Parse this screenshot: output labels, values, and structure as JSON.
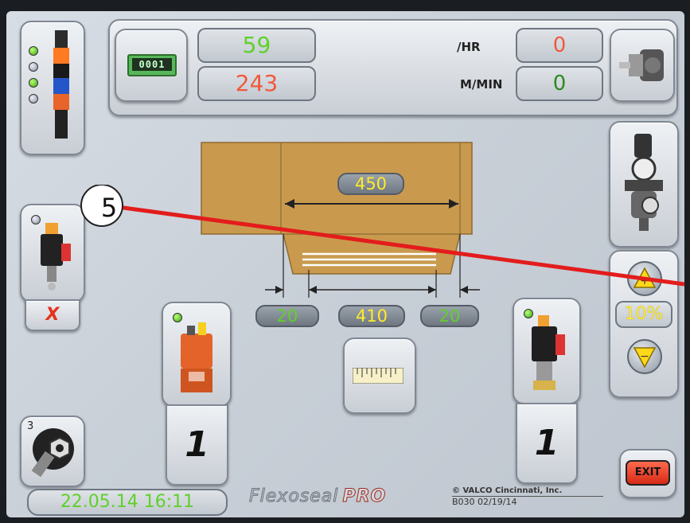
{
  "counter_top": "59",
  "counter_bottom": "243",
  "rate_label": "/HR",
  "rate_value": "0",
  "speed_label": "M/MIN",
  "speed_value": "0",
  "counter_icon_text": "0001",
  "box": {
    "width_value": "450",
    "left_flap": "20",
    "center": "410",
    "right_flap": "20"
  },
  "callout_number": "5",
  "gun_left_status": "X",
  "gun_bottom_left_count": "1",
  "gun_bottom_right_count": "1",
  "percent_value": "10%",
  "tools_badge": "3",
  "exit_label": "EXIT",
  "datetime": "22.05.14 16:11",
  "brand_name": "Flexoseal",
  "brand_suffix": "PRO",
  "copyright_line": "© VALCO Cincinnati, Inc.",
  "version_line": "B030 02/19/14",
  "colors": {
    "green_text": "#5fd12a",
    "red_text": "#f05a3c",
    "yellow_text": "#ffeb2a",
    "cardboard": "#c99a4e",
    "exit_red": "#e0301e"
  }
}
